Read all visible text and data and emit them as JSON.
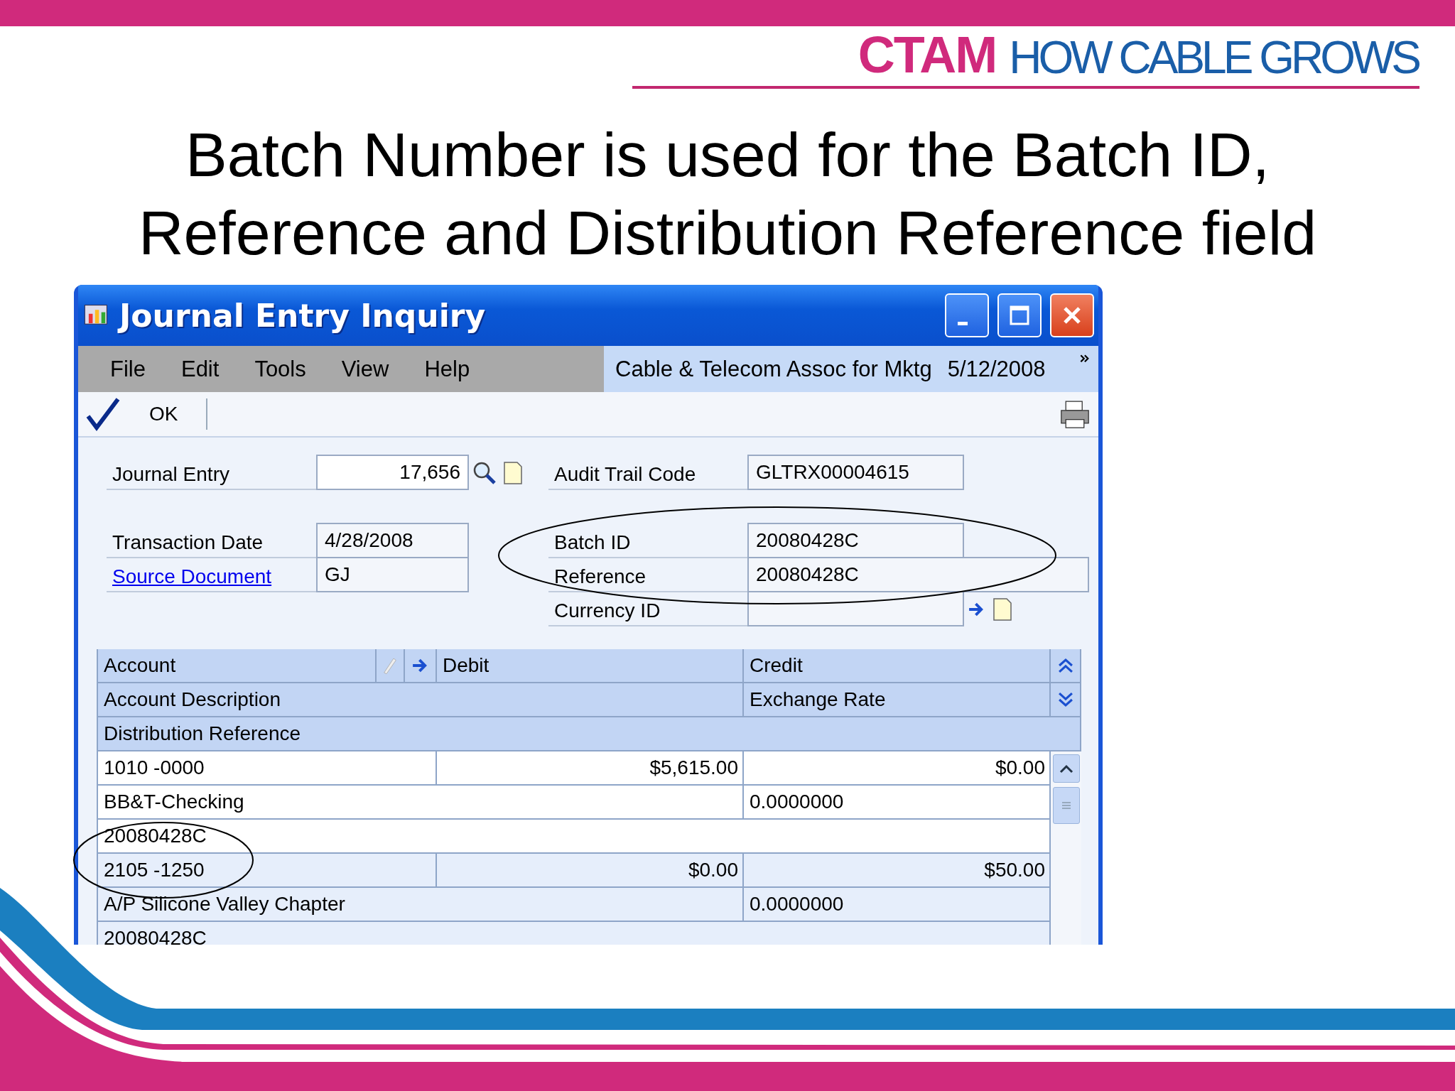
{
  "header": {
    "brand": "CTAM",
    "tagline": "HOW CABLE GROWS"
  },
  "slide_title": "Batch Number is used for the Batch ID, Reference and Distribution Reference field",
  "window": {
    "title": "Journal Entry Inquiry",
    "menu": [
      "File",
      "Edit",
      "Tools",
      "View",
      "Help"
    ],
    "company": "Cable & Telecom Assoc for Mktg",
    "date": "5/12/2008",
    "ok_button": "OK"
  },
  "form": {
    "journal_entry": {
      "label": "Journal Entry",
      "value": "17,656"
    },
    "audit_trail_code": {
      "label": "Audit Trail Code",
      "value": "GLTRX00004615"
    },
    "transaction_date": {
      "label": "Transaction Date",
      "value": "4/28/2008"
    },
    "source_document": {
      "label": "Source Document",
      "value": "GJ"
    },
    "batch_id": {
      "label": "Batch ID",
      "value": "20080428C"
    },
    "reference": {
      "label": "Reference",
      "value": "20080428C"
    },
    "currency_id": {
      "label": "Currency ID"
    }
  },
  "grid": {
    "columns": {
      "account": "Account",
      "debit": "Debit",
      "credit": "Credit",
      "account_description": "Account Description",
      "exchange_rate": "Exchange Rate",
      "distribution_reference": "Distribution Reference"
    },
    "rows": [
      {
        "account": "1010 -0000",
        "debit": "$5,615.00",
        "credit": "$0.00",
        "description": "BB&T-Checking",
        "exchange_rate": "0.0000000",
        "distribution_reference": "20080428C"
      },
      {
        "account": "2105 -1250",
        "debit": "$0.00",
        "credit": "$50.00",
        "description": "A/P Silicone Valley Chapter",
        "exchange_rate": "0.0000000",
        "distribution_reference": "20080428C"
      }
    ]
  }
}
